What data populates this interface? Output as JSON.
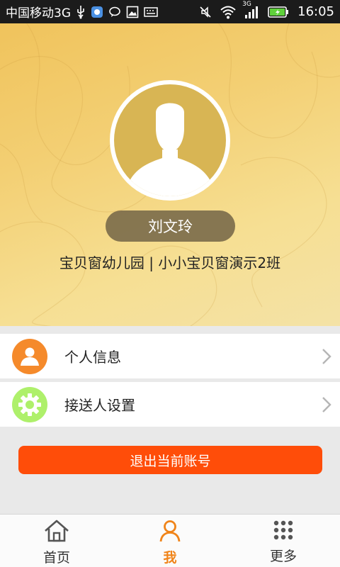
{
  "status_bar": {
    "carrier": "中国移动3G",
    "network_badge": "3G",
    "time": "16:05",
    "icons": [
      "usb-icon",
      "app-icon",
      "chat-icon",
      "image-icon",
      "keyboard-icon",
      "mute-icon",
      "wifi-icon",
      "signal-icon",
      "battery-icon"
    ]
  },
  "profile": {
    "name": "刘文玲",
    "school": "宝贝窗幼儿园 | 小小宝贝窗演示2班"
  },
  "menu": [
    {
      "label": "个人信息",
      "icon": "person-icon",
      "icon_bg": "#f58a2b"
    },
    {
      "label": "接送人设置",
      "icon": "gear-icon",
      "icon_bg": "#aef06b"
    }
  ],
  "logout_label": "退出当前账号",
  "tabs": [
    {
      "label": "首页",
      "icon": "home-icon",
      "active": false
    },
    {
      "label": "我",
      "icon": "profile-icon",
      "active": true
    },
    {
      "label": "更多",
      "icon": "grid-icon",
      "active": false
    }
  ],
  "colors": {
    "accent": "#f08419",
    "logout": "#ff4d09",
    "header": "#f3cf73"
  }
}
